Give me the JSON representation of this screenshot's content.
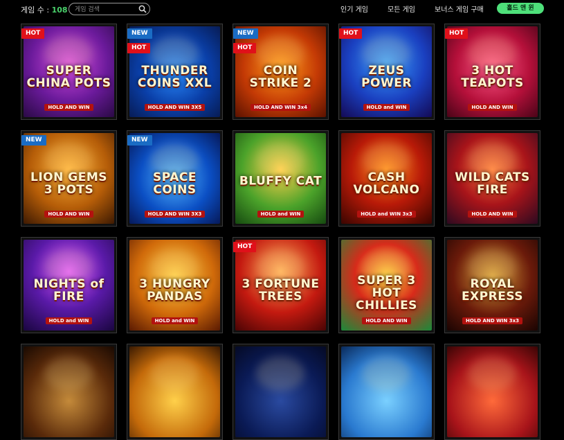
{
  "header": {
    "count_label": "게임 수 :",
    "count_value": "108",
    "search_placeholder": "게임 검색",
    "nav": [
      {
        "label": "인기 게임",
        "active": false
      },
      {
        "label": "모든 게임",
        "active": false
      },
      {
        "label": "보너스 게임 구매",
        "active": false
      },
      {
        "label": "홀드 앤 윈",
        "active": true
      }
    ]
  },
  "colors": {
    "accent_green": "#4ee07a",
    "count_green": "#49d16b",
    "hot_badge": "#e0101a",
    "new_badge": "#1a6cc4"
  },
  "games": [
    {
      "title": "SUPER CHINA POTS",
      "sub": "HOLD AND WIN",
      "badges": [
        "HOT"
      ]
    },
    {
      "title": "THUNDER COINS XXL",
      "sub": "HOLD AND WIN 3X5",
      "badges": [
        "NEW",
        "HOT"
      ]
    },
    {
      "title": "COIN STRIKE 2",
      "sub": "HOLD AND WIN 3x4",
      "badges": [
        "NEW",
        "HOT"
      ]
    },
    {
      "title": "ZEUS POWER",
      "sub": "HOLD and WIN",
      "badges": [
        "HOT"
      ]
    },
    {
      "title": "3 HOT TEAPOTS",
      "sub": "HOLD AND WIN",
      "badges": [
        "HOT"
      ]
    },
    {
      "title": "LION GEMS 3 POTS",
      "sub": "HOLD AND WIN",
      "badges": [
        "NEW"
      ]
    },
    {
      "title": "SPACE COINS",
      "sub": "HOLD AND WIN 3X3",
      "badges": [
        "NEW"
      ]
    },
    {
      "title": "BLUFFY CAT",
      "sub": "HOLD and WIN",
      "badges": []
    },
    {
      "title": "CASH VOLCANO",
      "sub": "HOLD and WIN 3x3",
      "badges": []
    },
    {
      "title": "WILD CATS FIRE",
      "sub": "HOLD AND WIN",
      "badges": []
    },
    {
      "title": "NIGHTS of FIRE",
      "sub": "HOLD and WIN",
      "badges": []
    },
    {
      "title": "3 HUNGRY PANDAS",
      "sub": "HOLD and WIN",
      "badges": []
    },
    {
      "title": "3 FORTUNE TREES",
      "sub": "",
      "badges": [
        "HOT"
      ]
    },
    {
      "title": "SUPER 3 HOT CHILLIES",
      "sub": "HOLD AND WIN",
      "badges": []
    },
    {
      "title": "ROYAL EXPRESS",
      "sub": "HOLD AND WIN 3x3",
      "badges": []
    },
    {
      "title": "",
      "sub": "",
      "badges": []
    },
    {
      "title": "",
      "sub": "",
      "badges": []
    },
    {
      "title": "",
      "sub": "",
      "badges": []
    },
    {
      "title": "",
      "sub": "",
      "badges": []
    },
    {
      "title": "",
      "sub": "",
      "badges": []
    }
  ]
}
